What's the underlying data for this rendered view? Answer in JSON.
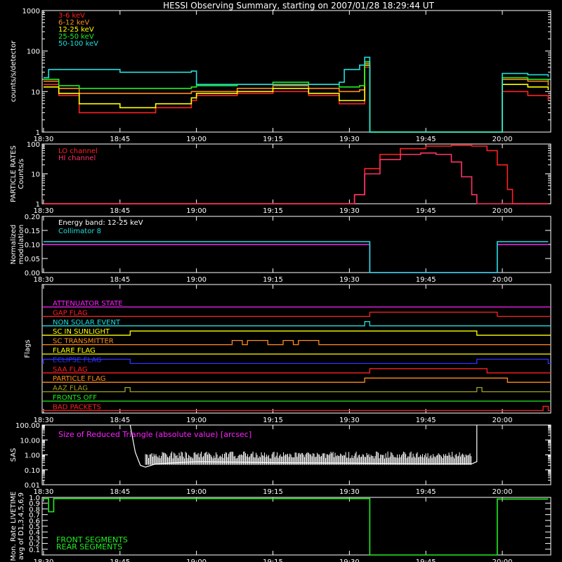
{
  "title": "HESSI Observing Summary, starting on 2007/01/28 18:29:44 UT",
  "time_ticks": [
    "18:30",
    "18:45",
    "19:00",
    "19:15",
    "19:30",
    "19:45",
    "20:00"
  ],
  "colors": {
    "red": "#ff2020",
    "orange": "#ff8c1a",
    "yellow": "#ffff00",
    "green": "#22ee22",
    "cyan": "#22dddd",
    "magenta": "#ff22ff",
    "blue": "#3030ff",
    "olive": "#a0a020",
    "pink": "#ff3366",
    "white": "#ffffff"
  },
  "chart_data": [
    {
      "type": "line",
      "ylabel": "counts/s/detector",
      "yscale": "log",
      "ylim": [
        1,
        1000
      ],
      "yticks": [
        "1",
        "10",
        "100",
        "1000"
      ],
      "legend_placement": "top-left",
      "series": [
        {
          "name": "3-6 keV",
          "color_key": "red",
          "x": [
            "18:30",
            "18:33",
            "18:37",
            "18:45",
            "18:52",
            "18:59",
            "19:00",
            "19:08",
            "19:15",
            "19:22",
            "19:28",
            "19:32",
            "19:33",
            "19:34",
            "19:59",
            "20:00",
            "20:05",
            "20:09"
          ],
          "y": [
            15,
            8,
            3,
            3,
            4,
            6,
            8,
            9,
            10,
            8,
            5,
            5,
            40,
            1,
            1,
            10,
            8,
            6
          ]
        },
        {
          "name": "6-12 keV",
          "color_key": "orange",
          "x": [
            "18:30",
            "18:33",
            "18:37",
            "18:45",
            "18:52",
            "18:59",
            "19:00",
            "19:08",
            "19:15",
            "19:22",
            "19:28",
            "19:32",
            "19:33",
            "19:34",
            "19:59",
            "20:00",
            "20:05",
            "20:09"
          ],
          "y": [
            18,
            12,
            9,
            9,
            9,
            10,
            10,
            12,
            14,
            12,
            10,
            11,
            50,
            1,
            1,
            20,
            18,
            14
          ]
        },
        {
          "name": "12-25 keV",
          "color_key": "yellow",
          "x": [
            "18:30",
            "18:33",
            "18:37",
            "18:45",
            "18:52",
            "18:59",
            "19:00",
            "19:08",
            "19:15",
            "19:22",
            "19:28",
            "19:32",
            "19:33",
            "19:34",
            "19:59",
            "20:00",
            "20:05",
            "20:09"
          ],
          "y": [
            13,
            9,
            5,
            4,
            5,
            7,
            9,
            10,
            12,
            9,
            6,
            6,
            45,
            1,
            1,
            15,
            13,
            11
          ]
        },
        {
          "name": "25-50 keV",
          "color_key": "green",
          "x": [
            "18:30",
            "18:33",
            "18:37",
            "18:45",
            "18:52",
            "18:59",
            "19:00",
            "19:08",
            "19:15",
            "19:22",
            "19:28",
            "19:32",
            "19:33",
            "19:34",
            "19:59",
            "20:00",
            "20:05",
            "20:09"
          ],
          "y": [
            20,
            14,
            12,
            12,
            12,
            13,
            14,
            15,
            17,
            15,
            13,
            14,
            55,
            1,
            1,
            22,
            20,
            18
          ]
        },
        {
          "name": "50-100 keV",
          "color_key": "cyan",
          "x": [
            "18:30",
            "18:31",
            "18:45",
            "18:59",
            "19:00",
            "19:28",
            "19:29",
            "19:32",
            "19:33",
            "19:34",
            "19:59",
            "20:00",
            "20:05",
            "20:09"
          ],
          "y": [
            22,
            35,
            30,
            32,
            15,
            17,
            35,
            45,
            70,
            1,
            1,
            28,
            26,
            23
          ]
        }
      ]
    },
    {
      "type": "line",
      "ylabel": "PARTICLE RATES Counts/s",
      "yscale": "log",
      "ylim": [
        1,
        100
      ],
      "yticks": [
        "1",
        "10",
        "100"
      ],
      "legend_placement": "top-left",
      "series": [
        {
          "name": "LO channel",
          "color_key": "red",
          "x": [
            "18:30",
            "19:30",
            "19:31",
            "19:33",
            "19:36",
            "19:40",
            "19:45",
            "19:50",
            "19:54",
            "19:57",
            "19:59",
            "20:01",
            "20:02",
            "20:09"
          ],
          "y": [
            1,
            1,
            2,
            15,
            45,
            70,
            85,
            90,
            85,
            60,
            20,
            3,
            1,
            1
          ]
        },
        {
          "name": "HI channel",
          "color_key": "pink",
          "x": [
            "18:30",
            "19:30",
            "19:31",
            "19:33",
            "19:36",
            "19:40",
            "19:44",
            "19:47",
            "19:50",
            "19:52",
            "19:54",
            "19:55",
            "20:09"
          ],
          "y": [
            1,
            1,
            2,
            10,
            30,
            45,
            50,
            45,
            25,
            8,
            2,
            1,
            1
          ]
        }
      ]
    },
    {
      "type": "line",
      "ylabel": "Normalized modulation",
      "ylim": [
        0,
        0.2
      ],
      "yticks": [
        "0.00",
        "0.05",
        "0.10",
        "0.15",
        "0.20"
      ],
      "legend_placement": "top-left",
      "annotations": [
        "Energy band: 12-25 keV"
      ],
      "series": [
        {
          "name": "",
          "color_key": "magenta",
          "x": [
            "18:30",
            "19:34",
            "19:34",
            "19:59",
            "19:59",
            "20:09"
          ],
          "y": [
            0.1,
            0.1,
            0.0,
            0.0,
            0.1,
            0.1
          ]
        },
        {
          "name": "Collimator 8",
          "color_key": "cyan",
          "x": [
            "18:30",
            "19:34",
            "19:34",
            "19:59",
            "19:59",
            "20:09"
          ],
          "y": [
            0.11,
            0.11,
            0.0,
            0.0,
            0.11,
            0.11
          ]
        }
      ]
    },
    {
      "type": "line",
      "ylabel": "Flags",
      "flags": [
        {
          "name": "ATTENUATOR STATE",
          "color_key": "magenta",
          "segments": []
        },
        {
          "name": "GAP FLAG",
          "color_key": "red",
          "segments": [
            [
              "19:34",
              "19:59"
            ]
          ]
        },
        {
          "name": "NON SOLAR EVENT",
          "color_key": "cyan",
          "segments": [
            [
              "19:33",
              "19:34"
            ]
          ]
        },
        {
          "name": "SC IN SUNLIGHT",
          "color_key": "yellow",
          "segments": [
            [
              "18:47",
              "19:55"
            ]
          ]
        },
        {
          "name": "SC TRANSMITTER",
          "color_key": "orange",
          "segments": [
            [
              "19:07",
              "19:09"
            ],
            [
              "19:10",
              "19:14"
            ],
            [
              "19:17",
              "19:19"
            ],
            [
              "19:20",
              "19:24"
            ]
          ]
        },
        {
          "name": "FLARE FLAG",
          "color_key": "yellow",
          "segments": []
        },
        {
          "name": "ECLIPSE FLAG",
          "color_key": "blue",
          "segments": [
            [
              "18:30",
              "18:47"
            ],
            [
              "19:55",
              "20:09"
            ]
          ]
        },
        {
          "name": "SAA FLAG",
          "color_key": "red",
          "segments": [
            [
              "19:34",
              "19:57"
            ]
          ]
        },
        {
          "name": "PARTICLE FLAG",
          "color_key": "orange",
          "segments": [
            [
              "19:33",
              "20:01"
            ]
          ]
        },
        {
          "name": "AAZ FLAG",
          "color_key": "olive",
          "segments": [
            [
              "18:46",
              "18:47"
            ],
            [
              "19:55",
              "19:56"
            ]
          ]
        },
        {
          "name": "FRONTS OFF",
          "color_key": "green",
          "segments": []
        },
        {
          "name": "BAD PACKETS",
          "color_key": "red",
          "segments": [
            [
              "20:08",
              "20:09"
            ]
          ]
        }
      ]
    },
    {
      "type": "line",
      "ylabel": "SAS",
      "yscale": "log",
      "ylim": [
        0.01,
        100
      ],
      "yticks": [
        "0.01",
        "0.10",
        "1.00",
        "10.00",
        "100.00"
      ],
      "annotations": [
        "Size of Reduced Triangle (absolute value) [arcsec]"
      ],
      "series": [
        {
          "name": "",
          "color_key": "white",
          "x": [
            "18:47",
            "18:48",
            "18:49",
            "18:50",
            "18:52",
            "19:00",
            "19:15",
            "19:30",
            "19:45",
            "19:54",
            "19:55",
            "19:55"
          ],
          "y": [
            100,
            1.5,
            0.2,
            0.15,
            0.25,
            0.35,
            0.3,
            0.28,
            0.25,
            0.25,
            0.35,
            100
          ]
        }
      ]
    },
    {
      "type": "line",
      "ylabel": "Mon. Rate LIVETIME avg of D1,3,4,5,6,9",
      "ylim": [
        0,
        1
      ],
      "yticks": [
        "0.1",
        "0.2",
        "0.3",
        "0.4",
        "0.5",
        "0.6",
        "0.7",
        "0.8",
        "0.9",
        "1.0"
      ],
      "legend_placement": "bottom-left",
      "series": [
        {
          "name": "FRONT SEGMENTS",
          "color_key": "green",
          "x": [
            "18:30",
            "18:31",
            "18:31",
            "18:32",
            "18:32",
            "19:34",
            "19:34",
            "19:59",
            "19:59",
            "20:09"
          ],
          "y": [
            0.98,
            0.98,
            0.75,
            0.75,
            0.98,
            0.98,
            0.0,
            0.0,
            0.97,
            0.97
          ]
        },
        {
          "name": "REAR SEGMENTS",
          "color_key": "green",
          "x": [],
          "y": []
        }
      ]
    }
  ]
}
